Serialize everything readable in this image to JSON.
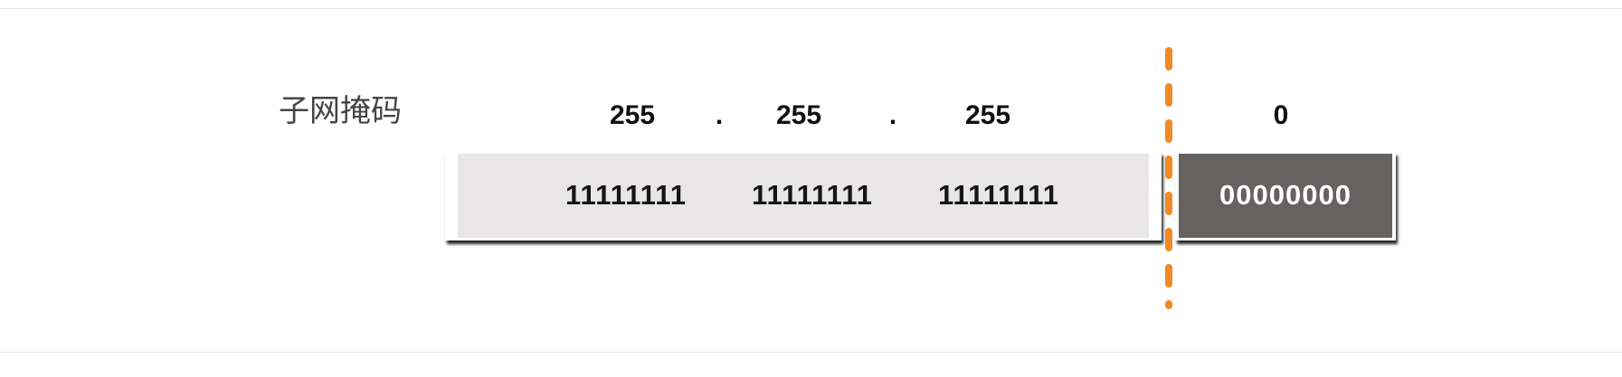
{
  "label": "子网掩码",
  "octets": [
    "255",
    "255",
    "255",
    "0"
  ],
  "separator": ".",
  "bits": {
    "network": [
      "11111111",
      "11111111",
      "11111111"
    ],
    "host": "00000000"
  },
  "colors": {
    "network_box": "#e8e6e6",
    "host_box": "#666262",
    "divider": "#f08a24"
  }
}
